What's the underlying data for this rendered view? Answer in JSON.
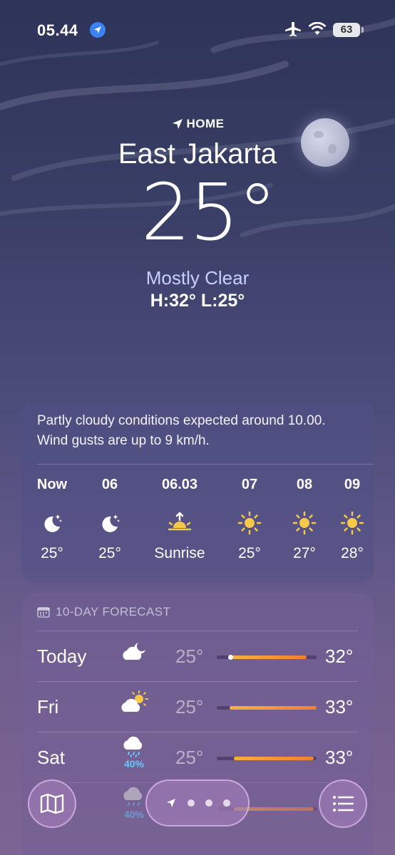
{
  "status_bar": {
    "time": "05.44",
    "battery": "63"
  },
  "header": {
    "home_label": "HOME",
    "city": "East Jakarta",
    "temperature": "25°",
    "condition": "Mostly Clear",
    "high_low": "H:32°  L:25°"
  },
  "hourly": {
    "summary": "Partly cloudy conditions expected around 10.00. Wind gusts are up to 9 km/h.",
    "items": [
      {
        "label": "Now",
        "icon": "moon-stars-icon",
        "value": "25°"
      },
      {
        "label": "06",
        "icon": "moon-stars-icon",
        "value": "25°"
      },
      {
        "label": "06.03",
        "icon": "sunrise-icon",
        "value": "Sunrise"
      },
      {
        "label": "07",
        "icon": "sun-icon",
        "value": "25°"
      },
      {
        "label": "08",
        "icon": "sun-icon",
        "value": "27°"
      },
      {
        "label": "09",
        "icon": "sun-icon",
        "value": "28°"
      }
    ]
  },
  "forecast": {
    "title": "10-DAY FORECAST",
    "days": [
      {
        "day": "Today",
        "icon": "cloud-moon-icon",
        "low": "25°",
        "high": "32°",
        "precip": ""
      },
      {
        "day": "Fri",
        "icon": "cloud-sun-icon",
        "low": "25°",
        "high": "33°",
        "precip": ""
      },
      {
        "day": "Sat",
        "icon": "cloud-rain-icon",
        "low": "25°",
        "high": "33°",
        "precip": "40%"
      },
      {
        "day": "",
        "icon": "cloud-rain-icon",
        "low": "",
        "high": "",
        "precip": "40%"
      }
    ]
  },
  "colors": {
    "accent_blue": "#3b82f6",
    "precip_blue": "#6cc6ff",
    "bar_start": "#f6b043",
    "bar_end": "#f07f33"
  }
}
